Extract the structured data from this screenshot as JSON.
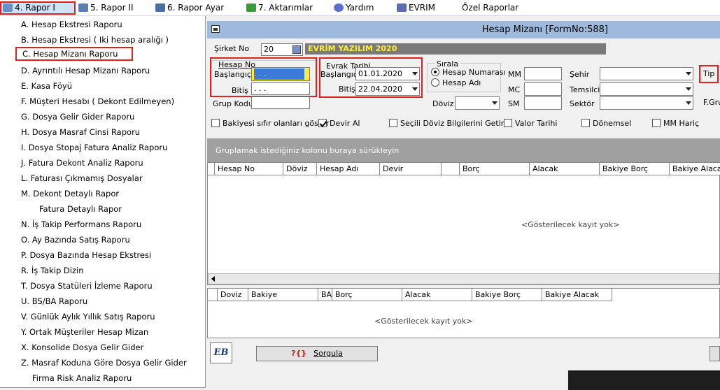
{
  "menubar": {
    "items": [
      {
        "label": "4.   Rapor I",
        "color": "#6b8fc7"
      },
      {
        "label": "5.   Rapor II",
        "color": "#5b7fb5"
      },
      {
        "label": "6.   Rapor Ayar",
        "color": "#4a6fa5"
      },
      {
        "label": "7.   Aktarımlar",
        "color": "#3c9a3c"
      },
      {
        "label": "Yardım",
        "color": "#5b6fd0"
      },
      {
        "label": "EVRIM",
        "color": "#5b6fb0"
      },
      {
        "label": "Özel Raporlar",
        "color": ""
      }
    ]
  },
  "dropdown": {
    "items": [
      "A.   Hesap Ekstresi Raporu",
      "B.   Hesap Ekstresi ( Iki hesap aralığı )",
      "C.   Hesap Mizanı Raporu",
      "D.   Ayrıntılı Hesap Mizanı Raporu",
      "E.   Kasa Föyü",
      "F.   Müşteri Hesabı ( Dekont Edilmeyen)",
      "G.   Dosya Gelir Gider Raporu",
      "H.   Dosya Masraf Cinsi Raporu",
      "I.   Dosya Stopaj Fatura Analiz Raporu",
      "J.   Fatura Dekont Analiz Raporu",
      "L.   Faturası Çıkmamış Dosyalar",
      "M.   Dekont Detaylı Rapor",
      "Fatura Detaylı Rapor",
      "N.   İş Takip Performans Raporu",
      "O.   Ay Bazında Satış Raporu",
      "P.   Dosya Bazında Hesap Ekstresi",
      "R.   İş Takip Dizin",
      "T.   Dosya Statüleri İzleme Raporu",
      "U.   BS/BA Raporu",
      "V. Günlük Aylık Yıllık Satış Raporu",
      "Y. Ortak Müşteriler Hesap Mizan",
      "X. Konsolide Dosya Gelir Gider",
      "Z. Masraf Koduna Göre Dosya Gelir Gider",
      "Firma Risk Analiz Raporu"
    ]
  },
  "window": {
    "title": "Hesap Mizanı [FormNo:588]"
  },
  "form": {
    "sirket_label": "Şirket No",
    "sirket_value": "20",
    "brand": "EVRİM YAZILIM  2020",
    "hesapno_title": "Hesap No",
    "baslangic_label": "Başlangıç",
    "baslangic_value": "  .  .  .  ",
    "bitis_label": "Bitiş",
    "bitis_value": "  .  .  .  ",
    "grupkodu_label": "Grup Kodu",
    "evrak_title": "Evrak Tarihi",
    "evrak_bas_label": "Başlangıç",
    "evrak_bas_value": "01.01.2020",
    "evrak_bit_label": "Bitiş",
    "evrak_bit_value": "22.04.2020",
    "sirala_title": "Sırala",
    "sirala_opt1": "Hesap Numarası",
    "sirala_opt2": "Hesap Adı",
    "doviz_label": "Döviz",
    "mm": "MM",
    "mc": "MC",
    "sm": "SM",
    "sehir": "Şehir",
    "temsilci": "Temsilci",
    "sektor": "Sektör",
    "tip": "Tip",
    "fgr": "F.Gru"
  },
  "checks": [
    {
      "label": "Bakiyesi sıfır olanları göster",
      "on": false
    },
    {
      "label": "Devir Al",
      "on": true
    },
    {
      "label": "Seçili Döviz Bilgilerini Getir",
      "on": false
    },
    {
      "label": "Valor Tarihi",
      "on": false
    },
    {
      "label": "Dönemsel",
      "on": false
    },
    {
      "label": "MM Hariç",
      "on": false
    }
  ],
  "group_hint": "Gruplamak istediğiniz kolonu buraya sürükleyin",
  "grid1": {
    "cols": [
      "",
      "Hesap No",
      "Döviz",
      "Hesap Adı",
      "Devir",
      "",
      "Borç",
      "Alacak",
      "Bakiye Borç",
      "Bakiye Alacak"
    ],
    "empty": "<Gösterilecek kayıt yok>"
  },
  "grid2": {
    "cols": [
      "",
      "Doviz",
      "Bakiye",
      "BA",
      "Borç",
      "Alacak",
      "Bakiye Borç",
      "Bakiye Alacak"
    ],
    "empty": "<Gösterilecek kayıt yok>"
  },
  "buttons": {
    "sorgula": "Sorgula",
    "sorgula_icon": "?{}",
    "eb": "EB"
  }
}
